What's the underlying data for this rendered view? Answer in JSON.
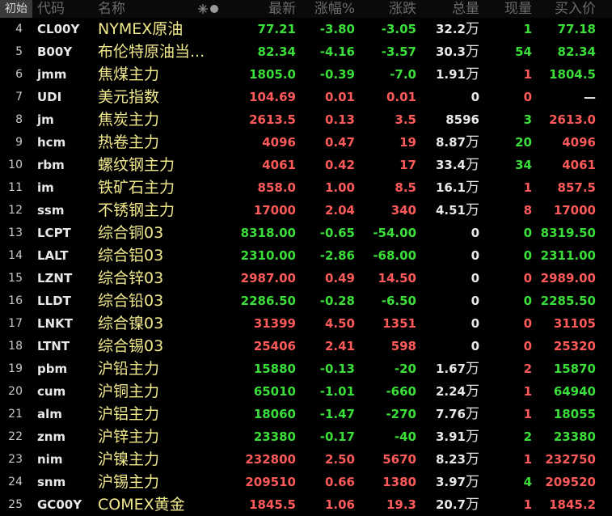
{
  "header": {
    "init_button": "初始",
    "code": "代码",
    "name": "名称",
    "last": "最新",
    "change_pct": "涨幅%",
    "change": "涨跌",
    "volume": "总量",
    "current_vol": "现量",
    "bid": "买入价",
    "settings_icon": "✷●"
  },
  "colors": {
    "up": "#ff5a5a",
    "down": "#3adf3a",
    "flat": "#e8e8e8",
    "name": "#f2e98c",
    "background": "#000000",
    "header_text": "#6a6a6a"
  },
  "rows": [
    {
      "index": "4",
      "code": "CL00Y",
      "name": "NYMEX原油",
      "last": "77.21",
      "change_pct": "-3.80",
      "change": "-3.05",
      "volume": "32.2",
      "volume_unit": "万",
      "current_vol": "1",
      "bid": "77.18",
      "dir": "down",
      "cur_dir": "down",
      "bid_dir": "down"
    },
    {
      "index": "5",
      "code": "B00Y",
      "name": "布伦特原油当...",
      "last": "82.34",
      "change_pct": "-4.16",
      "change": "-3.57",
      "volume": "30.3",
      "volume_unit": "万",
      "current_vol": "54",
      "bid": "82.34",
      "dir": "down",
      "cur_dir": "down",
      "bid_dir": "down"
    },
    {
      "index": "6",
      "code": "jmm",
      "name": "焦煤主力",
      "last": "1805.0",
      "change_pct": "-0.39",
      "change": "-7.0",
      "volume": "1.91",
      "volume_unit": "万",
      "current_vol": "1",
      "bid": "1804.5",
      "dir": "down",
      "cur_dir": "up",
      "bid_dir": "down"
    },
    {
      "index": "7",
      "code": "UDI",
      "name": "美元指数",
      "last": "104.69",
      "change_pct": "0.01",
      "change": "0.01",
      "volume": "0",
      "volume_unit": "",
      "current_vol": "0",
      "bid": "—",
      "dir": "up",
      "cur_dir": "up",
      "bid_dir": "flat"
    },
    {
      "index": "8",
      "code": "jm",
      "name": "焦炭主力",
      "last": "2613.5",
      "change_pct": "0.13",
      "change": "3.5",
      "volume": "8596",
      "volume_unit": "",
      "current_vol": "3",
      "bid": "2613.0",
      "dir": "up",
      "cur_dir": "down",
      "bid_dir": "up"
    },
    {
      "index": "9",
      "code": "hcm",
      "name": "热卷主力",
      "last": "4096",
      "change_pct": "0.47",
      "change": "19",
      "volume": "8.87",
      "volume_unit": "万",
      "current_vol": "20",
      "bid": "4096",
      "dir": "up",
      "cur_dir": "down",
      "bid_dir": "up"
    },
    {
      "index": "10",
      "code": "rbm",
      "name": "螺纹钢主力",
      "last": "4061",
      "change_pct": "0.42",
      "change": "17",
      "volume": "33.4",
      "volume_unit": "万",
      "current_vol": "34",
      "bid": "4061",
      "dir": "up",
      "cur_dir": "down",
      "bid_dir": "up"
    },
    {
      "index": "11",
      "code": "im",
      "name": "铁矿石主力",
      "last": "858.0",
      "change_pct": "1.00",
      "change": "8.5",
      "volume": "16.1",
      "volume_unit": "万",
      "current_vol": "1",
      "bid": "857.5",
      "dir": "up",
      "cur_dir": "up",
      "bid_dir": "up"
    },
    {
      "index": "12",
      "code": "ssm",
      "name": "不锈钢主力",
      "last": "17000",
      "change_pct": "2.04",
      "change": "340",
      "volume": "4.51",
      "volume_unit": "万",
      "current_vol": "8",
      "bid": "17000",
      "dir": "up",
      "cur_dir": "up",
      "bid_dir": "up"
    },
    {
      "index": "13",
      "code": "LCPT",
      "name": "综合铜03",
      "last": "8318.00",
      "change_pct": "-0.65",
      "change": "-54.00",
      "volume": "0",
      "volume_unit": "",
      "current_vol": "0",
      "bid": "8319.50",
      "dir": "down",
      "cur_dir": "down",
      "bid_dir": "down"
    },
    {
      "index": "14",
      "code": "LALT",
      "name": "综合铝03",
      "last": "2310.00",
      "change_pct": "-2.86",
      "change": "-68.00",
      "volume": "0",
      "volume_unit": "",
      "current_vol": "0",
      "bid": "2311.00",
      "dir": "down",
      "cur_dir": "down",
      "bid_dir": "down"
    },
    {
      "index": "15",
      "code": "LZNT",
      "name": "综合锌03",
      "last": "2987.00",
      "change_pct": "0.49",
      "change": "14.50",
      "volume": "0",
      "volume_unit": "",
      "current_vol": "0",
      "bid": "2989.00",
      "dir": "up",
      "cur_dir": "up",
      "bid_dir": "up"
    },
    {
      "index": "16",
      "code": "LLDT",
      "name": "综合铅03",
      "last": "2286.50",
      "change_pct": "-0.28",
      "change": "-6.50",
      "volume": "0",
      "volume_unit": "",
      "current_vol": "0",
      "bid": "2285.50",
      "dir": "down",
      "cur_dir": "down",
      "bid_dir": "down"
    },
    {
      "index": "17",
      "code": "LNKT",
      "name": "综合镍03",
      "last": "31399",
      "change_pct": "4.50",
      "change": "1351",
      "volume": "0",
      "volume_unit": "",
      "current_vol": "0",
      "bid": "31105",
      "dir": "up",
      "cur_dir": "up",
      "bid_dir": "up"
    },
    {
      "index": "18",
      "code": "LTNT",
      "name": "综合锡03",
      "last": "25406",
      "change_pct": "2.41",
      "change": "598",
      "volume": "0",
      "volume_unit": "",
      "current_vol": "0",
      "bid": "25320",
      "dir": "up",
      "cur_dir": "up",
      "bid_dir": "up"
    },
    {
      "index": "19",
      "code": "pbm",
      "name": "沪铅主力",
      "last": "15880",
      "change_pct": "-0.13",
      "change": "-20",
      "volume": "1.67",
      "volume_unit": "万",
      "current_vol": "2",
      "bid": "15870",
      "dir": "down",
      "cur_dir": "up",
      "bid_dir": "down"
    },
    {
      "index": "20",
      "code": "cum",
      "name": "沪铜主力",
      "last": "65010",
      "change_pct": "-1.01",
      "change": "-660",
      "volume": "2.24",
      "volume_unit": "万",
      "current_vol": "1",
      "bid": "64940",
      "dir": "down",
      "cur_dir": "up",
      "bid_dir": "down"
    },
    {
      "index": "21",
      "code": "alm",
      "name": "沪铝主力",
      "last": "18060",
      "change_pct": "-1.47",
      "change": "-270",
      "volume": "7.76",
      "volume_unit": "万",
      "current_vol": "1",
      "bid": "18055",
      "dir": "down",
      "cur_dir": "up",
      "bid_dir": "down"
    },
    {
      "index": "22",
      "code": "znm",
      "name": "沪锌主力",
      "last": "23380",
      "change_pct": "-0.17",
      "change": "-40",
      "volume": "3.91",
      "volume_unit": "万",
      "current_vol": "2",
      "bid": "23380",
      "dir": "down",
      "cur_dir": "down",
      "bid_dir": "down"
    },
    {
      "index": "23",
      "code": "nim",
      "name": "沪镍主力",
      "last": "232800",
      "change_pct": "2.50",
      "change": "5670",
      "volume": "8.23",
      "volume_unit": "万",
      "current_vol": "1",
      "bid": "232750",
      "dir": "up",
      "cur_dir": "up",
      "bid_dir": "up"
    },
    {
      "index": "24",
      "code": "snm",
      "name": "沪锡主力",
      "last": "209510",
      "change_pct": "0.66",
      "change": "1380",
      "volume": "3.97",
      "volume_unit": "万",
      "current_vol": "4",
      "bid": "209520",
      "dir": "up",
      "cur_dir": "down",
      "bid_dir": "up"
    },
    {
      "index": "25",
      "code": "GC00Y",
      "name": "COMEX黄金",
      "last": "1845.5",
      "change_pct": "1.06",
      "change": "19.3",
      "volume": "20.7",
      "volume_unit": "万",
      "current_vol": "1",
      "bid": "1845.2",
      "dir": "up",
      "cur_dir": "up",
      "bid_dir": "up"
    }
  ]
}
